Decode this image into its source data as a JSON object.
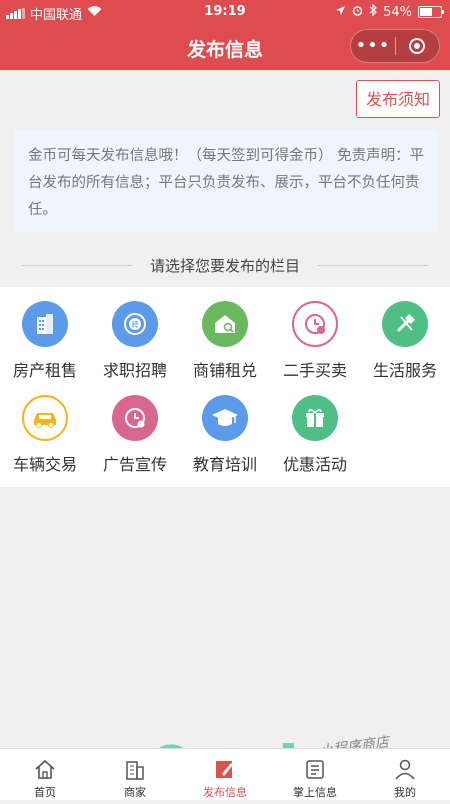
{
  "status_bar": {
    "carrier": "中国联通",
    "time": "19:19",
    "battery": "54%",
    "battery_level": 0.54
  },
  "navbar": {
    "title": "发布信息"
  },
  "notice_button": {
    "label": "发布须知"
  },
  "info": {
    "text": "金币可每天发布信息哦！（每天签到可得金币） 免责声明：平台发布的所有信息；平台只负责发布、展示，平台不负任何责任。"
  },
  "section_title": "请选择您要发布的栏目",
  "categories": [
    {
      "label": "房产租售",
      "icon": "building-icon",
      "color": "#5b9bea"
    },
    {
      "label": "求职招聘",
      "icon": "recruit-icon",
      "color": "#5b9bea"
    },
    {
      "label": "商铺租兑",
      "icon": "shop-icon",
      "color": "#6ab860"
    },
    {
      "label": "二手买卖",
      "icon": "secondhand-clock-icon",
      "color": "#d9668e"
    },
    {
      "label": "生活服务",
      "icon": "tools-icon",
      "color": "#4fbf85"
    },
    {
      "label": "车辆交易",
      "icon": "car-icon",
      "color": "#f2b61c"
    },
    {
      "label": "广告宣传",
      "icon": "ad-clock-icon",
      "color": "#d9668e"
    },
    {
      "label": "教育培训",
      "icon": "graduation-cap-icon",
      "color": "#5b9bea"
    },
    {
      "label": "优惠活动",
      "icon": "gift-icon",
      "color": "#4fbf85"
    }
  ],
  "tabs": [
    {
      "label": "首页",
      "icon": "home-icon",
      "active": false
    },
    {
      "label": "商家",
      "icon": "store-icon",
      "active": false
    },
    {
      "label": "发布信息",
      "icon": "edit-icon",
      "active": true
    },
    {
      "label": "掌上信息",
      "icon": "news-icon",
      "active": false
    },
    {
      "label": "我的",
      "icon": "user-icon",
      "active": false
    }
  ],
  "watermark": {
    "text": "9wd",
    "suffix": ".com",
    "tagline": "小程序商店"
  }
}
